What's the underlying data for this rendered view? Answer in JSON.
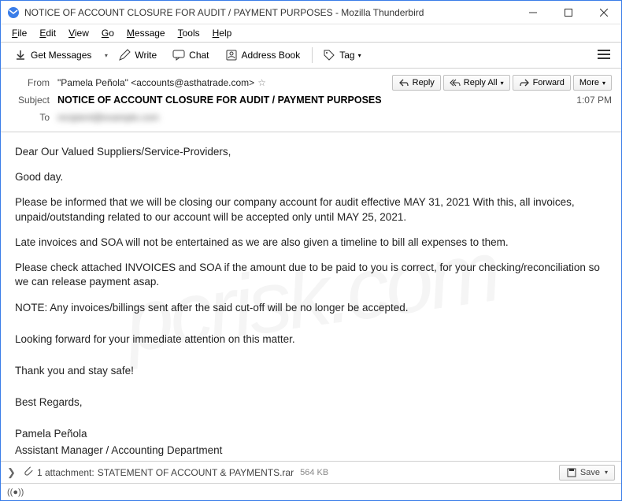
{
  "titlebar": {
    "title": "NOTICE OF ACCOUNT CLOSURE FOR AUDIT / PAYMENT PURPOSES - Mozilla Thunderbird"
  },
  "menubar": [
    "File",
    "Edit",
    "View",
    "Go",
    "Message",
    "Tools",
    "Help"
  ],
  "toolbar": {
    "get_messages": "Get Messages",
    "write": "Write",
    "chat": "Chat",
    "address_book": "Address Book",
    "tag": "Tag"
  },
  "header": {
    "from_label": "From",
    "from_value": "\"Pamela Peñola\" <accounts@asthatrade.com>",
    "subject_label": "Subject",
    "subject_value": "NOTICE OF ACCOUNT CLOSURE FOR AUDIT / PAYMENT PURPOSES",
    "time": "1:07 PM",
    "to_label": "To",
    "to_value": "recipient@example.com",
    "actions": {
      "reply": "Reply",
      "reply_all": "Reply All",
      "forward": "Forward",
      "more": "More"
    }
  },
  "body": {
    "p1": "Dear Our Valued Suppliers/Service-Providers,",
    "p2": "Good day.",
    "p3": "Please be informed that we will be closing our company account for audit effective MAY 31, 2021 With this, all invoices, unpaid/outstanding related to our account will be accepted only until MAY 25, 2021.",
    "p4": "Late invoices and SOA will not be entertained as we are also given a timeline to bill all expenses to them.",
    "p5": "Please check attached INVOICES and SOA if the amount due to be paid to you is correct, for your checking/reconciliation so we can release payment asap.",
    "p6": "NOTE: Any invoices/billings sent after the said cut-off will be no longer be accepted.",
    "p7": "Looking forward for your immediate attention on this matter.",
    "p8": "Thank you and stay safe!",
    "p9": "Best Regards,",
    "p10": "Pamela Peñola",
    "p11": "Assistant Manager / Accounting Department"
  },
  "attachment": {
    "count_text": "1 attachment:",
    "name": "STATEMENT OF ACCOUNT & PAYMENTS.rar",
    "size": "564 KB",
    "save": "Save"
  },
  "watermark": "pcrisk.com"
}
